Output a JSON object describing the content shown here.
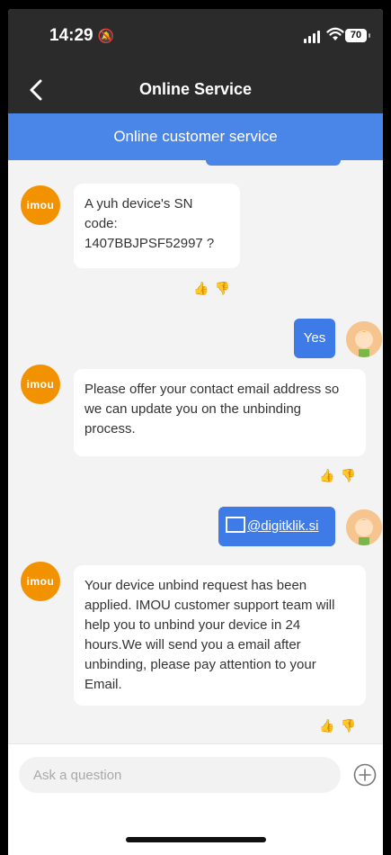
{
  "status_bar": {
    "time": "14:29",
    "battery": "70"
  },
  "nav": {
    "title": "Online Service"
  },
  "banner": {
    "text": "Online customer service"
  },
  "avatar_brand": "imou",
  "messages": [
    {
      "from": "agent",
      "lines": [
        "A yuh device's SN code:",
        "1407BBJPSF52997 ?"
      ]
    },
    {
      "from": "user",
      "text": "Yes"
    },
    {
      "from": "agent",
      "lines": [
        "Please offer your contact email address so",
        "we can update you on the unbinding",
        "process."
      ]
    },
    {
      "from": "user",
      "text": "@digitklik.si"
    },
    {
      "from": "agent",
      "lines": [
        "Your device unbind request has been",
        "applied. IMOU customer support team will",
        "help you to unbind your device in 24",
        "hours.We will send you a email after",
        "unbinding, please pay attention to your",
        "Email."
      ]
    }
  ],
  "input": {
    "placeholder": "Ask a question"
  },
  "colors": {
    "accent": "#4a86e8",
    "brand": "#f39200",
    "dark_bar": "#2b2b2b"
  }
}
